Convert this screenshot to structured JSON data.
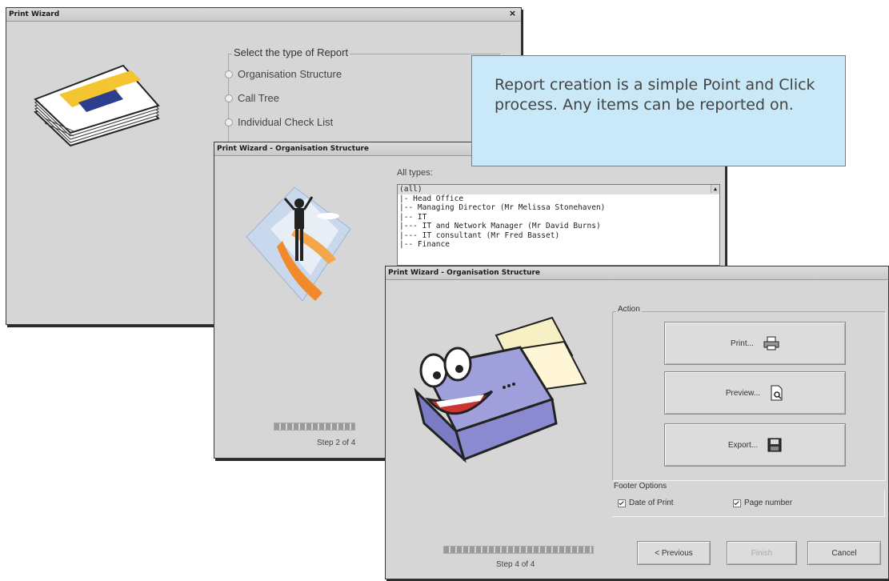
{
  "window1": {
    "title": "Print Wizard",
    "close_icon": "close-icon",
    "group_label": "Select the type of Report",
    "options": [
      "Organisation Structure",
      "Call Tree",
      "Individual Check List"
    ]
  },
  "window2": {
    "title": "Print Wizard - Organisation Structure",
    "list_label": "All types:",
    "list_items": [
      "(all)",
      "|- Head Office",
      "|-- Managing Director (Mr Melissa Stonehaven)",
      "|-- IT",
      "|--- IT and Network Manager (Mr David Burns)",
      "|--- IT consultant (Mr Fred Basset)",
      "|-- Finance"
    ],
    "step": "Step 2 of 4"
  },
  "window3": {
    "title": "Print Wizard - Organisation Structure",
    "action_label": "Action",
    "buttons": {
      "print": "Print...",
      "preview": "Preview...",
      "export": "Export..."
    },
    "footer_label": "Footer Options",
    "footer_options": {
      "date_of_print": "Date of Print",
      "page_number": "Page number"
    },
    "step": "Step 4 of 4",
    "nav": {
      "previous": "< Previous",
      "finish": "Finish",
      "cancel": "Cancel"
    }
  },
  "callout": {
    "text": "Report creation is a simple Point and Click process.  Any items can be reported on."
  },
  "colors": {
    "window_bg": "#d6d6d6",
    "callout_bg": "#c9e9f8",
    "text": "#444444"
  }
}
